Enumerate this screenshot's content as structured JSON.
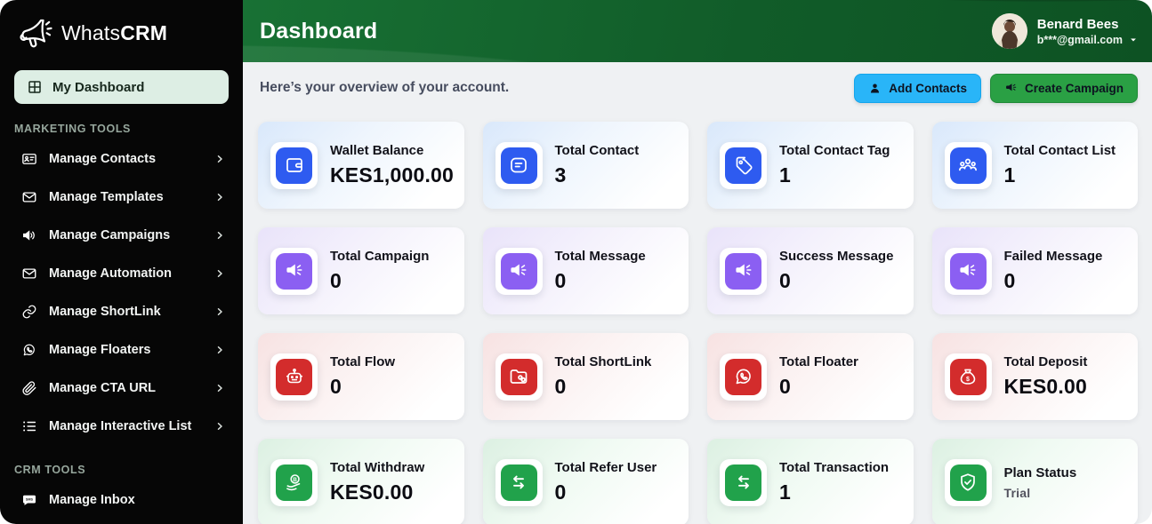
{
  "brand": {
    "name_light": "Whats",
    "name_bold": "CRM"
  },
  "sidebar": {
    "dashboard": {
      "label": "My Dashboard",
      "icon": "grid-icon"
    },
    "sections": [
      {
        "label": "MARKETING TOOLS",
        "items": [
          {
            "label": "Manage Contacts",
            "icon": "contact-card-icon"
          },
          {
            "label": "Manage Templates",
            "icon": "envelope-icon"
          },
          {
            "label": "Manage Campaigns",
            "icon": "speaker-icon"
          },
          {
            "label": "Manage Automation",
            "icon": "envelope-icon"
          },
          {
            "label": "Manage ShortLink",
            "icon": "chain-icon"
          },
          {
            "label": "Manage Floaters",
            "icon": "whatsapp-icon"
          },
          {
            "label": "Manage CTA URL",
            "icon": "paperclip-icon"
          },
          {
            "label": "Manage Interactive List",
            "icon": "list-icon"
          }
        ]
      },
      {
        "label": "CRM TOOLS",
        "items": [
          {
            "label": "Manage Inbox",
            "icon": "chat-sms-icon",
            "no_chevron": true
          }
        ]
      }
    ]
  },
  "header": {
    "title": "Dashboard",
    "user": {
      "name": "Benard Bees",
      "email": "b***@gmail.com"
    }
  },
  "overview": {
    "message": "Here’s your overview of your account.",
    "add_contacts_label": "Add Contacts",
    "create_campaign_label": "Create Campaign"
  },
  "cards": [
    {
      "label": "Wallet Balance",
      "value": "KES1,000.00",
      "color": "blue",
      "icon": "wallet-icon"
    },
    {
      "label": "Total Contact",
      "value": "3",
      "color": "blue",
      "icon": "message-square-icon"
    },
    {
      "label": "Total Contact Tag",
      "value": "1",
      "color": "blue",
      "icon": "tag-icon"
    },
    {
      "label": "Total Contact List",
      "value": "1",
      "color": "blue",
      "icon": "users-icon"
    },
    {
      "label": "Total Campaign",
      "value": "0",
      "color": "purple",
      "icon": "megaphone-icon"
    },
    {
      "label": "Total Message",
      "value": "0",
      "color": "purple",
      "icon": "megaphone-icon"
    },
    {
      "label": "Success Message",
      "value": "0",
      "color": "purple",
      "icon": "megaphone-icon"
    },
    {
      "label": "Failed Message",
      "value": "0",
      "color": "purple",
      "icon": "megaphone-icon"
    },
    {
      "label": "Total Flow",
      "value": "0",
      "color": "red",
      "icon": "robot-icon"
    },
    {
      "label": "Total ShortLink",
      "value": "0",
      "color": "red",
      "icon": "folder-link-icon"
    },
    {
      "label": "Total Floater",
      "value": "0",
      "color": "red",
      "icon": "whatsapp-icon"
    },
    {
      "label": "Total Deposit",
      "value": "KES0.00",
      "color": "red",
      "icon": "money-bag-icon"
    },
    {
      "label": "Total Withdraw",
      "value": "KES0.00",
      "color": "green",
      "icon": "hand-coin-icon"
    },
    {
      "label": "Total Refer User",
      "value": "0",
      "color": "green",
      "icon": "swap-arrows-icon"
    },
    {
      "label": "Total Transaction",
      "value": "1",
      "color": "green",
      "icon": "swap-arrows-icon"
    },
    {
      "label": "Plan Status",
      "value": "Trial",
      "color": "green",
      "icon": "shield-check-icon",
      "muted": true
    }
  ],
  "colors": {
    "sidebar_bg": "#060606",
    "header_green": "#115c29",
    "active_item_bg": "#ddeee4",
    "accent_blue": "#2e5bf0",
    "accent_purple": "#8b5ff2",
    "accent_red": "#d32c2c",
    "accent_green": "#21a24b",
    "button_cyan": "#29b5f8",
    "button_green": "#2aa044"
  }
}
